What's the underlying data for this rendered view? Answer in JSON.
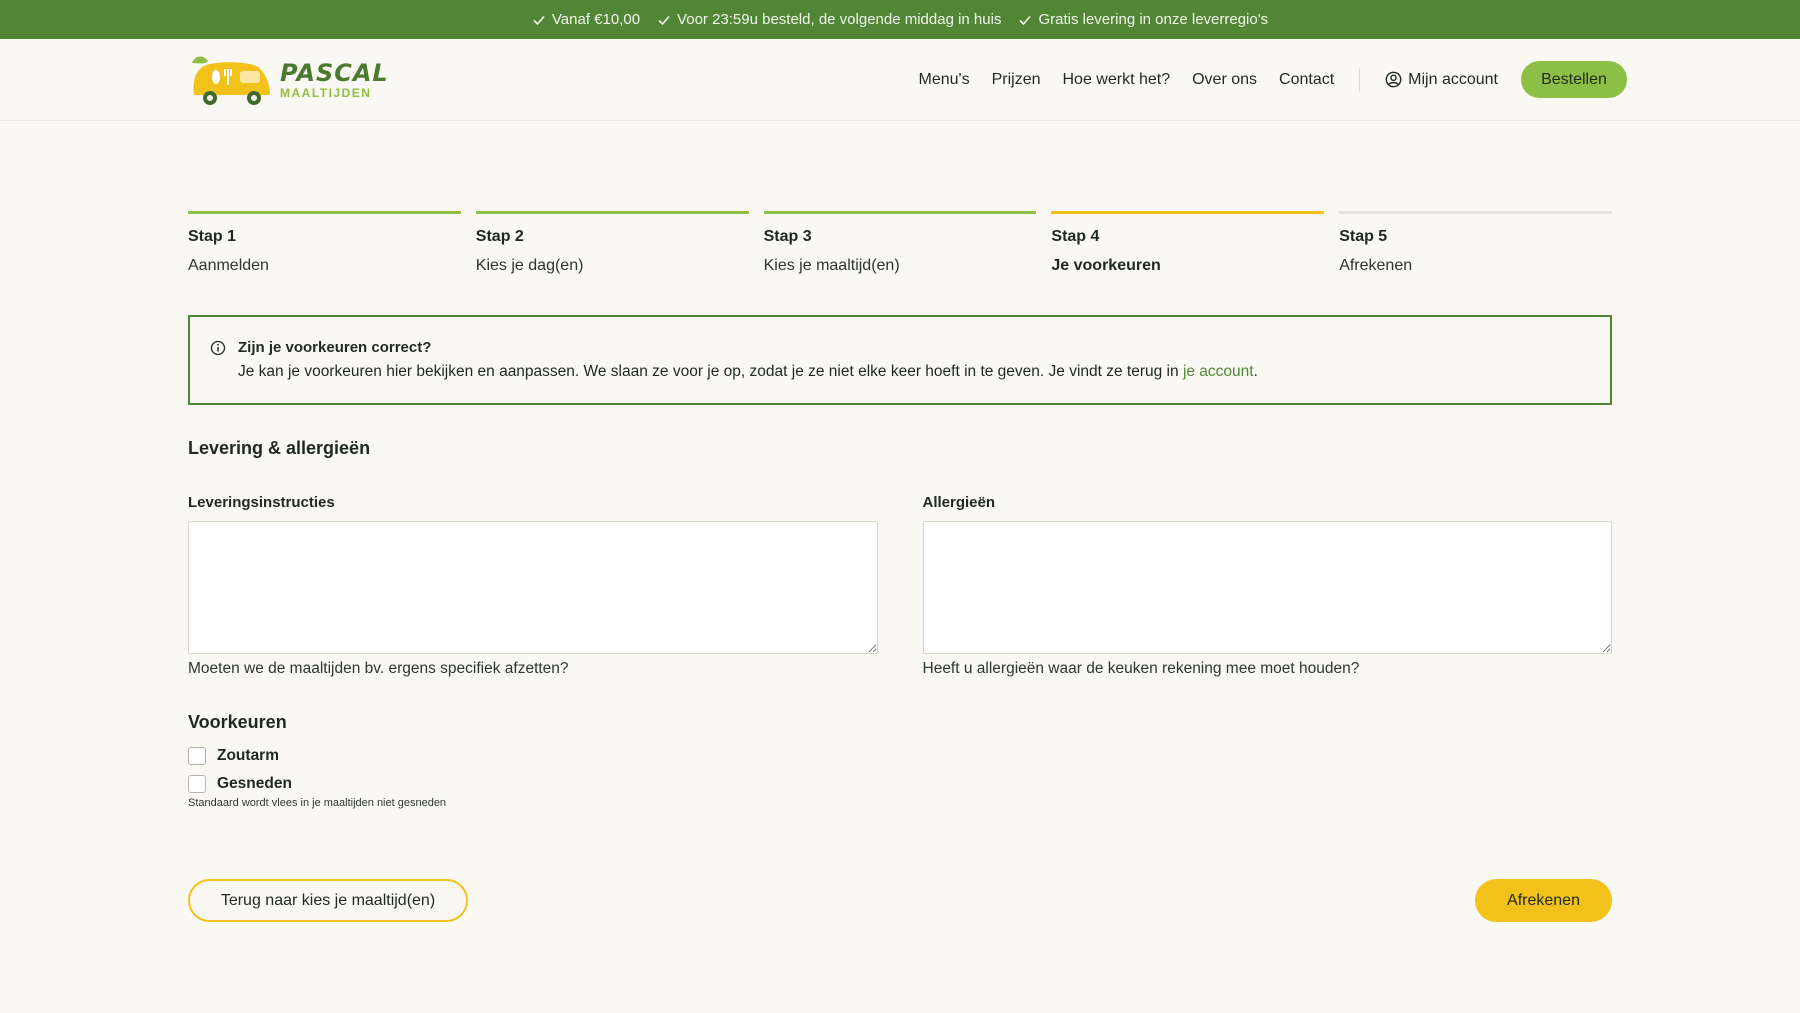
{
  "topbar": {
    "usps": [
      "Vanaf €10,00",
      "Voor 23:59u besteld, de volgende middag in huis",
      "Gratis levering in onze leverregio's"
    ]
  },
  "logo": {
    "line1": "PASCAL",
    "line2": "MAALTIJDEN"
  },
  "nav": {
    "items": [
      "Menu's",
      "Prijzen",
      "Hoe werkt het?",
      "Over ons",
      "Contact"
    ],
    "account": "Mijn account",
    "order": "Bestellen"
  },
  "steps": [
    {
      "num": "Stap 1",
      "label": "Aanmelden",
      "state": "done"
    },
    {
      "num": "Stap 2",
      "label": "Kies je dag(en)",
      "state": "done"
    },
    {
      "num": "Stap 3",
      "label": "Kies je maaltijd(en)",
      "state": "done"
    },
    {
      "num": "Stap 4",
      "label": "Je voorkeuren",
      "state": "current"
    },
    {
      "num": "Stap 5",
      "label": "Afrekenen",
      "state": "future"
    }
  ],
  "info": {
    "title": "Zijn je voorkeuren correct?",
    "text": "Je kan je voorkeuren hier bekijken en aanpassen. We slaan ze voor je op, zodat je ze niet elke keer hoeft in te geven. Je vindt ze terug in",
    "link": "je account",
    "end": "."
  },
  "delivery": {
    "heading": "Levering & allergieën",
    "instructions": {
      "label": "Leveringsinstructies",
      "value": "",
      "help": "Moeten we de maaltijden bv. ergens specifiek afzetten?"
    },
    "allergies": {
      "label": "Allergieën",
      "value": "",
      "help": "Heeft u allergieën waar de keuken rekening mee moet houden?"
    }
  },
  "preferences": {
    "heading": "Voorkeuren",
    "options": [
      {
        "label": "Zoutarm",
        "checked": false
      },
      {
        "label": "Gesneden",
        "checked": false
      }
    ],
    "help": "Standaard wordt vlees in je maaltijden niet gesneden"
  },
  "actions": {
    "back": "Terug naar kies je maaltijd(en)",
    "next": "Afrekenen"
  },
  "colors": {
    "green_dark": "#528637",
    "green_light": "#8dbf46",
    "yellow": "#f2c21b"
  }
}
